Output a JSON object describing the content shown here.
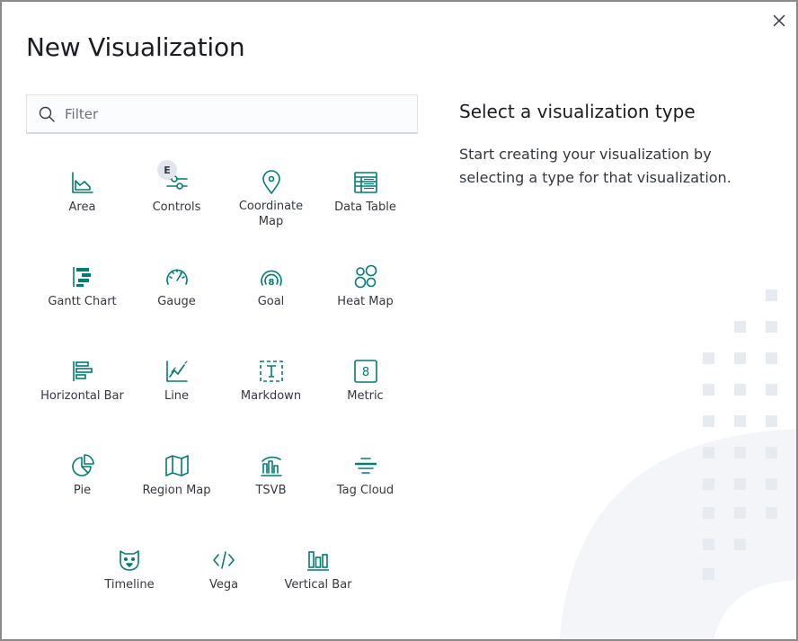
{
  "dialog": {
    "title": "New Visualization",
    "close_icon": "close-icon"
  },
  "search": {
    "placeholder": "Filter",
    "value": "",
    "icon": "search-icon"
  },
  "types": [
    {
      "label": "Area",
      "icon": "area-chart-icon"
    },
    {
      "label": "Controls",
      "icon": "controls-icon",
      "badge": "E"
    },
    {
      "label": "Coordinate Map",
      "icon": "map-marker-icon"
    },
    {
      "label": "Data Table",
      "icon": "table-icon"
    },
    {
      "label": "Gantt Chart",
      "icon": "gantt-chart-icon"
    },
    {
      "label": "Gauge",
      "icon": "gauge-icon"
    },
    {
      "label": "Goal",
      "icon": "goal-icon"
    },
    {
      "label": "Heat Map",
      "icon": "heatmap-icon"
    },
    {
      "label": "Horizontal Bar",
      "icon": "horizontal-bar-icon"
    },
    {
      "label": "Line",
      "icon": "line-chart-icon"
    },
    {
      "label": "Markdown",
      "icon": "markdown-icon"
    },
    {
      "label": "Metric",
      "icon": "metric-icon"
    },
    {
      "label": "Pie",
      "icon": "pie-chart-icon"
    },
    {
      "label": "Region Map",
      "icon": "region-map-icon"
    },
    {
      "label": "TSVB",
      "icon": "tsvb-icon"
    },
    {
      "label": "Tag Cloud",
      "icon": "tag-cloud-icon"
    },
    {
      "label": "Timeline",
      "icon": "timeline-icon"
    },
    {
      "label": "Vega",
      "icon": "vega-icon"
    },
    {
      "label": "Vertical Bar",
      "icon": "vertical-bar-icon"
    }
  ],
  "side": {
    "title": "Select a visualization type",
    "description": "Start creating your visualization by selecting a type for that visualization."
  },
  "colors": {
    "accent": "#017d73",
    "text": "#343741",
    "title": "#1a1c21",
    "decor": "#eef2f7"
  }
}
